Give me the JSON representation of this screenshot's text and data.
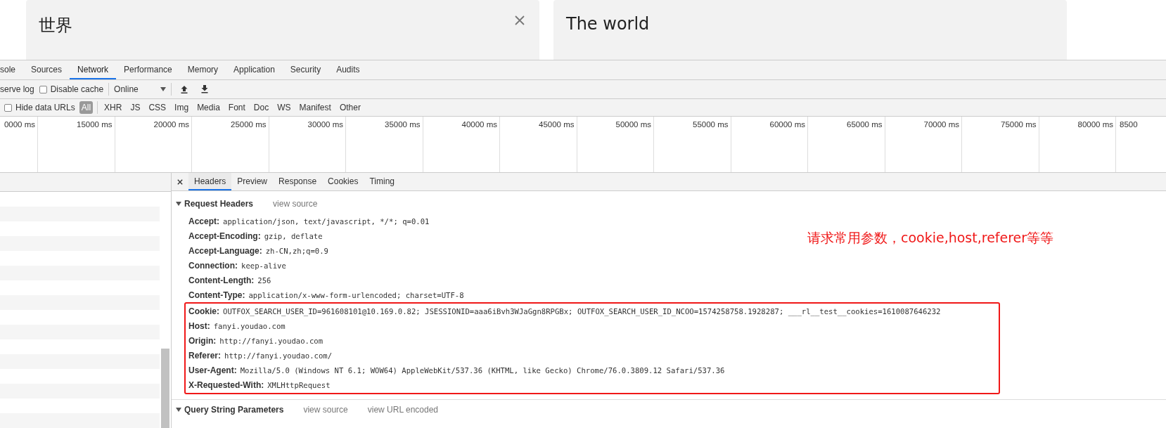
{
  "translator": {
    "source_text": "世界",
    "target_text": "The world"
  },
  "devtools": {
    "tabs": [
      {
        "label": "sole",
        "selected": false
      },
      {
        "label": "Sources",
        "selected": false
      },
      {
        "label": "Network",
        "selected": true
      },
      {
        "label": "Performance",
        "selected": false
      },
      {
        "label": "Memory",
        "selected": false
      },
      {
        "label": "Application",
        "selected": false
      },
      {
        "label": "Security",
        "selected": false
      },
      {
        "label": "Audits",
        "selected": false
      }
    ],
    "toolbar": {
      "preserve_log_label": "serve log",
      "disable_cache": {
        "label": "Disable cache",
        "checked": false
      },
      "throttling": "Online"
    },
    "filter": {
      "hide_data_urls": {
        "label": "Hide data URLs",
        "checked": false
      },
      "types": [
        {
          "label": "All",
          "selected": true
        },
        {
          "label": "XHR",
          "selected": false
        },
        {
          "label": "JS",
          "selected": false
        },
        {
          "label": "CSS",
          "selected": false
        },
        {
          "label": "Img",
          "selected": false
        },
        {
          "label": "Media",
          "selected": false
        },
        {
          "label": "Font",
          "selected": false
        },
        {
          "label": "Doc",
          "selected": false
        },
        {
          "label": "WS",
          "selected": false
        },
        {
          "label": "Manifest",
          "selected": false
        },
        {
          "label": "Other",
          "selected": false
        }
      ]
    },
    "timeline_ticks": [
      "0000 ms",
      "15000 ms",
      "20000 ms",
      "25000 ms",
      "30000 ms",
      "35000 ms",
      "40000 ms",
      "45000 ms",
      "50000 ms",
      "55000 ms",
      "60000 ms",
      "65000 ms",
      "70000 ms",
      "75000 ms",
      "80000 ms",
      "8500"
    ],
    "detail_tabs": [
      {
        "label": "Headers",
        "selected": true
      },
      {
        "label": "Preview",
        "selected": false
      },
      {
        "label": "Response",
        "selected": false
      },
      {
        "label": "Cookies",
        "selected": false
      },
      {
        "label": "Timing",
        "selected": false
      }
    ],
    "sections": [
      {
        "title": "Request Headers",
        "expanded": true,
        "links": [
          "view source"
        ],
        "headers": [
          {
            "name": "Accept:",
            "value": "application/json, text/javascript, */*; q=0.01",
            "highlighted": false
          },
          {
            "name": "Accept-Encoding:",
            "value": "gzip, deflate",
            "highlighted": false
          },
          {
            "name": "Accept-Language:",
            "value": "zh-CN,zh;q=0.9",
            "highlighted": false
          },
          {
            "name": "Connection:",
            "value": "keep-alive",
            "highlighted": false
          },
          {
            "name": "Content-Length:",
            "value": "256",
            "highlighted": false
          },
          {
            "name": "Content-Type:",
            "value": "application/x-www-form-urlencoded; charset=UTF-8",
            "highlighted": false
          },
          {
            "name": "Cookie:",
            "value": "OUTFOX_SEARCH_USER_ID=961608101@10.169.0.82; JSESSIONID=aaa6iBvh3WJaGgn8RPGBx; OUTFOX_SEARCH_USER_ID_NCOO=1574258758.1928287; ___rl__test__cookies=1610087646232",
            "highlighted": true
          },
          {
            "name": "Host:",
            "value": "fanyi.youdao.com",
            "highlighted": true
          },
          {
            "name": "Origin:",
            "value": "http://fanyi.youdao.com",
            "highlighted": true
          },
          {
            "name": "Referer:",
            "value": "http://fanyi.youdao.com/",
            "highlighted": true
          },
          {
            "name": "User-Agent:",
            "value": "Mozilla/5.0 (Windows NT 6.1; WOW64) AppleWebKit/537.36 (KHTML, like Gecko) Chrome/76.0.3809.12 Safari/537.36",
            "highlighted": true
          },
          {
            "name": "X-Requested-With:",
            "value": "XMLHttpRequest",
            "highlighted": true
          }
        ]
      },
      {
        "title": "Query String Parameters",
        "expanded": true,
        "links": [
          "view source",
          "view URL encoded"
        ]
      }
    ]
  },
  "annotation": "请求常用参数，cookie,host,referer等等"
}
